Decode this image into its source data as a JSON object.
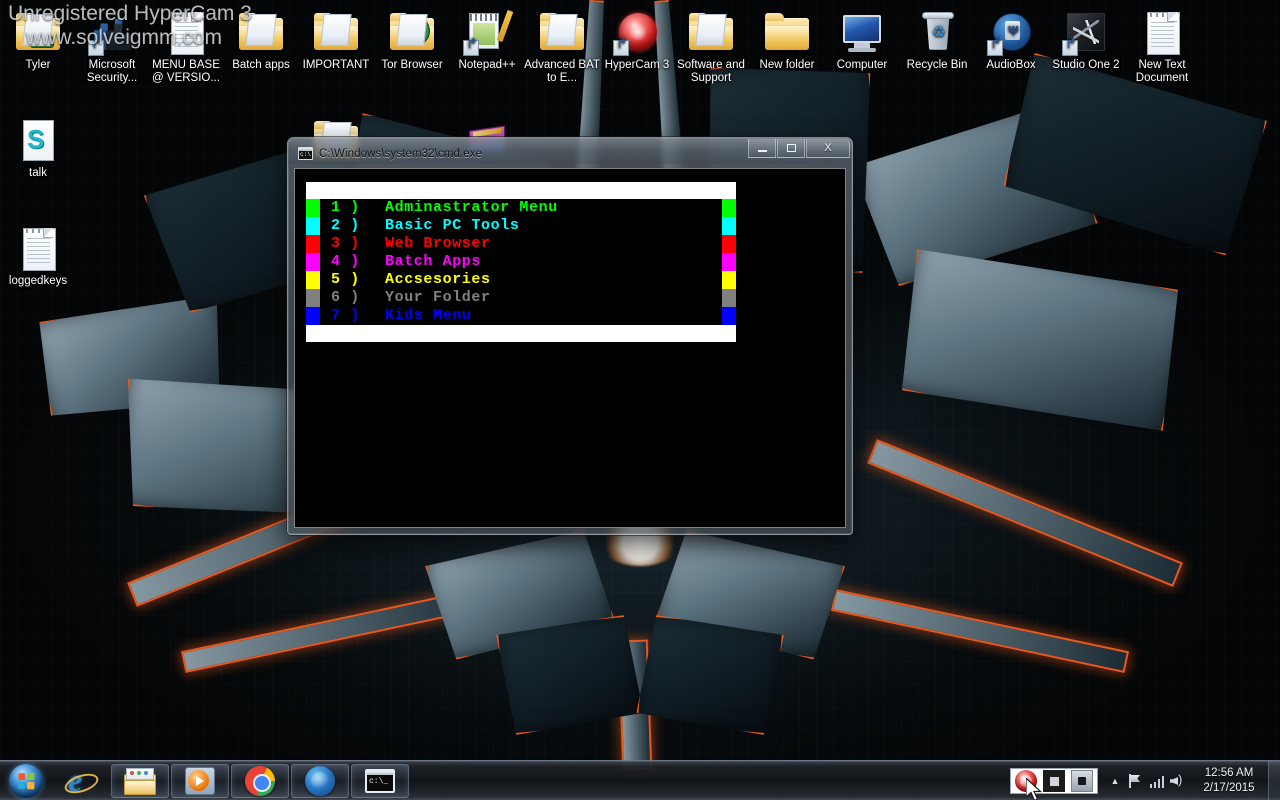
{
  "watermark": {
    "line1": "Unregistered HyperCam 3",
    "line2": "www.solveigmm.com"
  },
  "desktop": {
    "icons": [
      {
        "label": "Tyler",
        "type": "folder-user"
      },
      {
        "label": "Microsoft Security...",
        "type": "security"
      },
      {
        "label": "MENU BASE @ VERSIO...",
        "type": "document"
      },
      {
        "label": "Batch apps",
        "type": "folder"
      },
      {
        "label": "IMPORTANT",
        "type": "folder"
      },
      {
        "label": "Tor Browser",
        "type": "folder-globe"
      },
      {
        "label": "Notepad++",
        "type": "notepad-plus-plus"
      },
      {
        "label": "Advanced BAT to E...",
        "type": "folder"
      },
      {
        "label": "HyperCam 3",
        "type": "hypercam-orb"
      },
      {
        "label": "Software and Support",
        "type": "folder"
      },
      {
        "label": "New folder",
        "type": "folder-plain"
      },
      {
        "label": "Computer",
        "type": "computer"
      },
      {
        "label": "Recycle Bin",
        "type": "recycle-bin"
      },
      {
        "label": "AudioBox",
        "type": "audiobox-usb"
      },
      {
        "label": "Studio One 2",
        "type": "studio-one-tile"
      },
      {
        "label": "New Text Document",
        "type": "document"
      },
      {
        "label": "talk",
        "type": "talk-doc"
      },
      {
        "label": "loggedkeys",
        "type": "document"
      }
    ]
  },
  "cmd_window": {
    "title": "C:\\Windows\\system32\\cmd.exe",
    "buttons": {
      "minimize": "minimize",
      "maximize": "maximize",
      "close": "X"
    },
    "menu": {
      "items": [
        {
          "num": "1 )",
          "label": "Adminastrator Menu",
          "color": "#00ff00"
        },
        {
          "num": "2 )",
          "label": "Basic PC Tools",
          "color": "#00ffff"
        },
        {
          "num": "3 )",
          "label": "Web Browser",
          "color": "#ff0000"
        },
        {
          "num": "4 )",
          "label": "Batch Apps",
          "color": "#ff00ff"
        },
        {
          "num": "5 )",
          "label": "Accsesories",
          "color": "#ffff00"
        },
        {
          "num": "6 )",
          "label": "Your Folder",
          "color": "#808080"
        },
        {
          "num": "7 )",
          "label": "Kids Menu",
          "color": "#0000ff"
        }
      ]
    }
  },
  "taskbar": {
    "start": "Start",
    "items": [
      {
        "name": "internet-explorer",
        "label": "Internet Explorer",
        "pinned_open": false
      },
      {
        "name": "windows-explorer",
        "label": "Windows Explorer",
        "pinned_open": true
      },
      {
        "name": "windows-media-player",
        "label": "Windows Media Player",
        "pinned_open": true
      },
      {
        "name": "google-chrome",
        "label": "Google Chrome",
        "pinned_open": true
      },
      {
        "name": "firefox",
        "label": "Mozilla Firefox",
        "pinned_open": true
      },
      {
        "name": "command-prompt",
        "label": "C:\\Windows\\system32\\cmd.exe",
        "pinned_open": true
      }
    ],
    "tray": {
      "hypercam": {
        "record": "Record",
        "stop": "Stop",
        "pause": "Pause"
      },
      "chevron": "▲",
      "action_center": "Action Center",
      "network": "Network",
      "volume": "Volume",
      "clock": {
        "time": "12:56 AM",
        "date": "2/17/2015"
      },
      "show_desktop": "Show desktop"
    }
  },
  "colors": {
    "accent_orange": "#e8591d",
    "console_bg": "#000000",
    "console_bar": "#ffffff"
  }
}
